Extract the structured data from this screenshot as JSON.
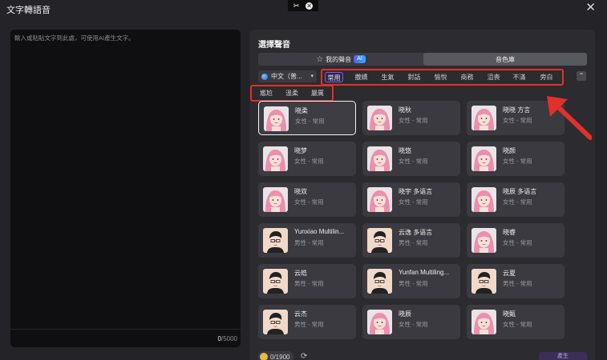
{
  "window": {
    "title": "文字轉語音",
    "close_glyph": "✕"
  },
  "top_control": {
    "icon_a": "✂",
    "icon_b": "✕"
  },
  "editor": {
    "placeholder": "輸入或粘貼文字到此處，可使用AI產生文字。",
    "count_current": "0",
    "count_max": "/5000"
  },
  "voice_panel": {
    "title": "選擇聲音",
    "my_voice_label": "我的聲音",
    "ai_badge": "AI",
    "library_label": "音色庫",
    "language": "中文（普...",
    "categories_row1": [
      "常用",
      "撒嬌",
      "生氣",
      "對話",
      "愉悅",
      "商務",
      "沮喪",
      "不滿",
      "旁白"
    ],
    "categories_row2": [
      "尷尬",
      "溫柔",
      "嚴厲"
    ],
    "active_category": "常用",
    "collapse_glyph": "⌃",
    "voices": [
      {
        "name": "晓柔",
        "desc": "女性 - 常用",
        "gender": "female",
        "selected": true
      },
      {
        "name": "晓秋",
        "desc": "女性 - 常用",
        "gender": "female"
      },
      {
        "name": "晓晓 方言",
        "desc": "女性 - 常用",
        "gender": "female"
      },
      {
        "name": "晓梦",
        "desc": "女性 - 常用",
        "gender": "female"
      },
      {
        "name": "晓悠",
        "desc": "女性 - 常用",
        "gender": "female"
      },
      {
        "name": "晓颜",
        "desc": "女性 - 常用",
        "gender": "female"
      },
      {
        "name": "晓双",
        "desc": "女性 - 常用",
        "gender": "female"
      },
      {
        "name": "晓宇 多语言",
        "desc": "女性 - 常用",
        "gender": "female"
      },
      {
        "name": "晓辰 多语言",
        "desc": "女性 - 常用",
        "gender": "female"
      },
      {
        "name": "Yunxiao Multilin...",
        "desc": "男性 - 常用",
        "gender": "male"
      },
      {
        "name": "云逸 多语言",
        "desc": "男性 - 常用",
        "gender": "male"
      },
      {
        "name": "晓睿",
        "desc": "女性 - 常用",
        "gender": "female"
      },
      {
        "name": "云皓",
        "desc": "男性 - 常用",
        "gender": "male"
      },
      {
        "name": "Yunfan Multiling...",
        "desc": "男性 - 常用",
        "gender": "male"
      },
      {
        "name": "云夏",
        "desc": "男性 - 常用",
        "gender": "male"
      },
      {
        "name": "云杰",
        "desc": "男性 - 常用",
        "gender": "male"
      },
      {
        "name": "晓辰",
        "desc": "女性 - 常用",
        "gender": "female"
      },
      {
        "name": "晓甄",
        "desc": "女性 - 常用",
        "gender": "female"
      }
    ],
    "credits": "0/1900",
    "refresh_glyph": "⟳",
    "generate_label": "產生"
  },
  "colors": {
    "highlight": "#e3302a",
    "accent": "#8a55e8"
  }
}
